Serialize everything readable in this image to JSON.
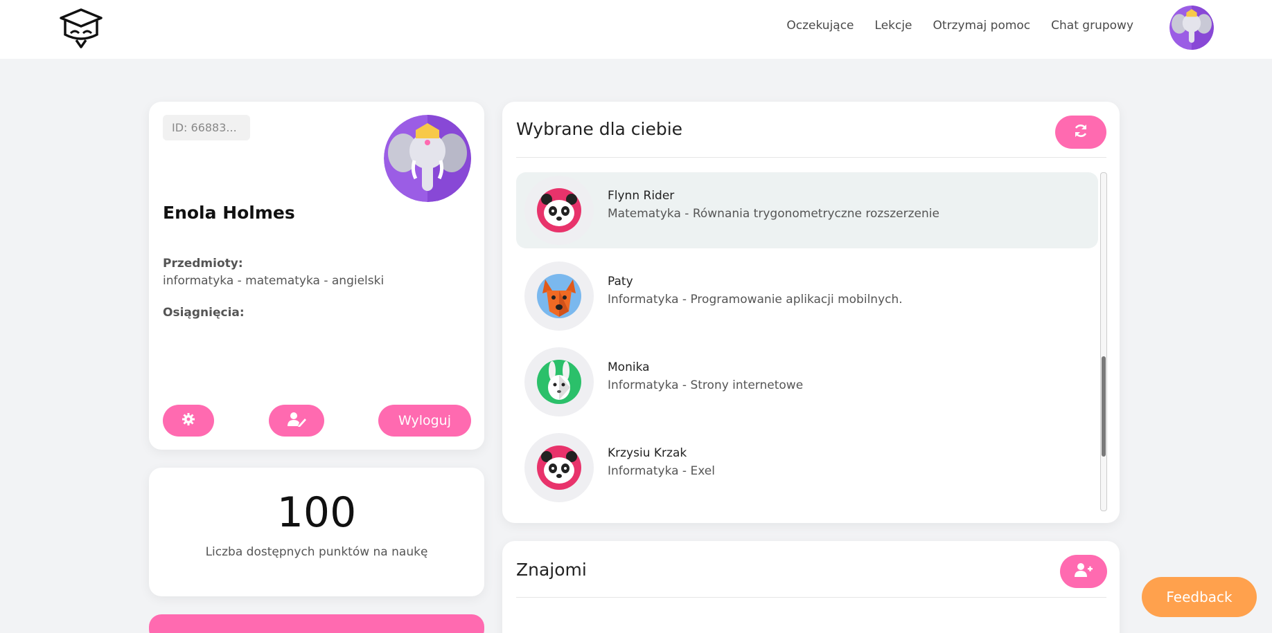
{
  "header": {
    "nav": [
      "Oczekujące",
      "Lekcje",
      "Otrzymaj pomoc",
      "Chat grupowy"
    ]
  },
  "profile": {
    "id_text": "ID: 66883...",
    "name": "Enola Holmes",
    "subjects_label": "Przedmioty:",
    "subjects": "informatyka - matematyka - angielski",
    "achievements_label": "Osiągnięcia:",
    "logout_label": "Wyloguj"
  },
  "points": {
    "value": "100",
    "label": "Liczba dostępnych punktów na naukę"
  },
  "chosen": {
    "title": "Wybrane dla ciebie",
    "items": [
      {
        "name": "Flynn Rider",
        "desc": "Matematyka - Równania trygonometryczne rozszerzenie",
        "avatar": "panda-icon"
      },
      {
        "name": "Paty",
        "desc": "Informatyka - Programowanie aplikacji mobilnych.",
        "avatar": "dog-icon"
      },
      {
        "name": "Monika",
        "desc": "Informatyka - Strony internetowe",
        "avatar": "rabbit-icon"
      },
      {
        "name": "Krzysiu Krzak",
        "desc": "Informatyka - Exel",
        "avatar": "panda-icon"
      }
    ]
  },
  "friends": {
    "title": "Znajomi"
  },
  "feedback_label": "Feedback",
  "colors": {
    "accent_pink": "#ff6ab0",
    "feedback_orange": "#ffa14d",
    "background": "#f2f3f5"
  }
}
